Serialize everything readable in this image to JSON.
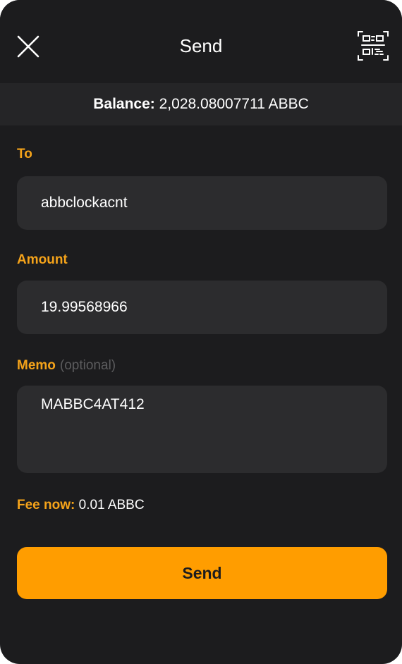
{
  "header": {
    "title": "Send",
    "close_icon": "close-icon",
    "scan_icon": "qr-scan-icon"
  },
  "balance": {
    "label": "Balance:",
    "value": "2,028.08007711 ABBC"
  },
  "form": {
    "to": {
      "label": "To",
      "value": "abbclockacnt"
    },
    "amount": {
      "label": "Amount",
      "value": "19.99568966"
    },
    "memo": {
      "label": "Memo",
      "hint": "(optional)",
      "value": "MABBC4AT412"
    }
  },
  "fee": {
    "label": "Fee now:",
    "value": "0.01 ABBC"
  },
  "send_button": {
    "label": "Send"
  },
  "colors": {
    "background": "#1c1c1e",
    "accent": "#f5a31a",
    "button": "#ff9d00",
    "field": "#2c2c2e"
  }
}
